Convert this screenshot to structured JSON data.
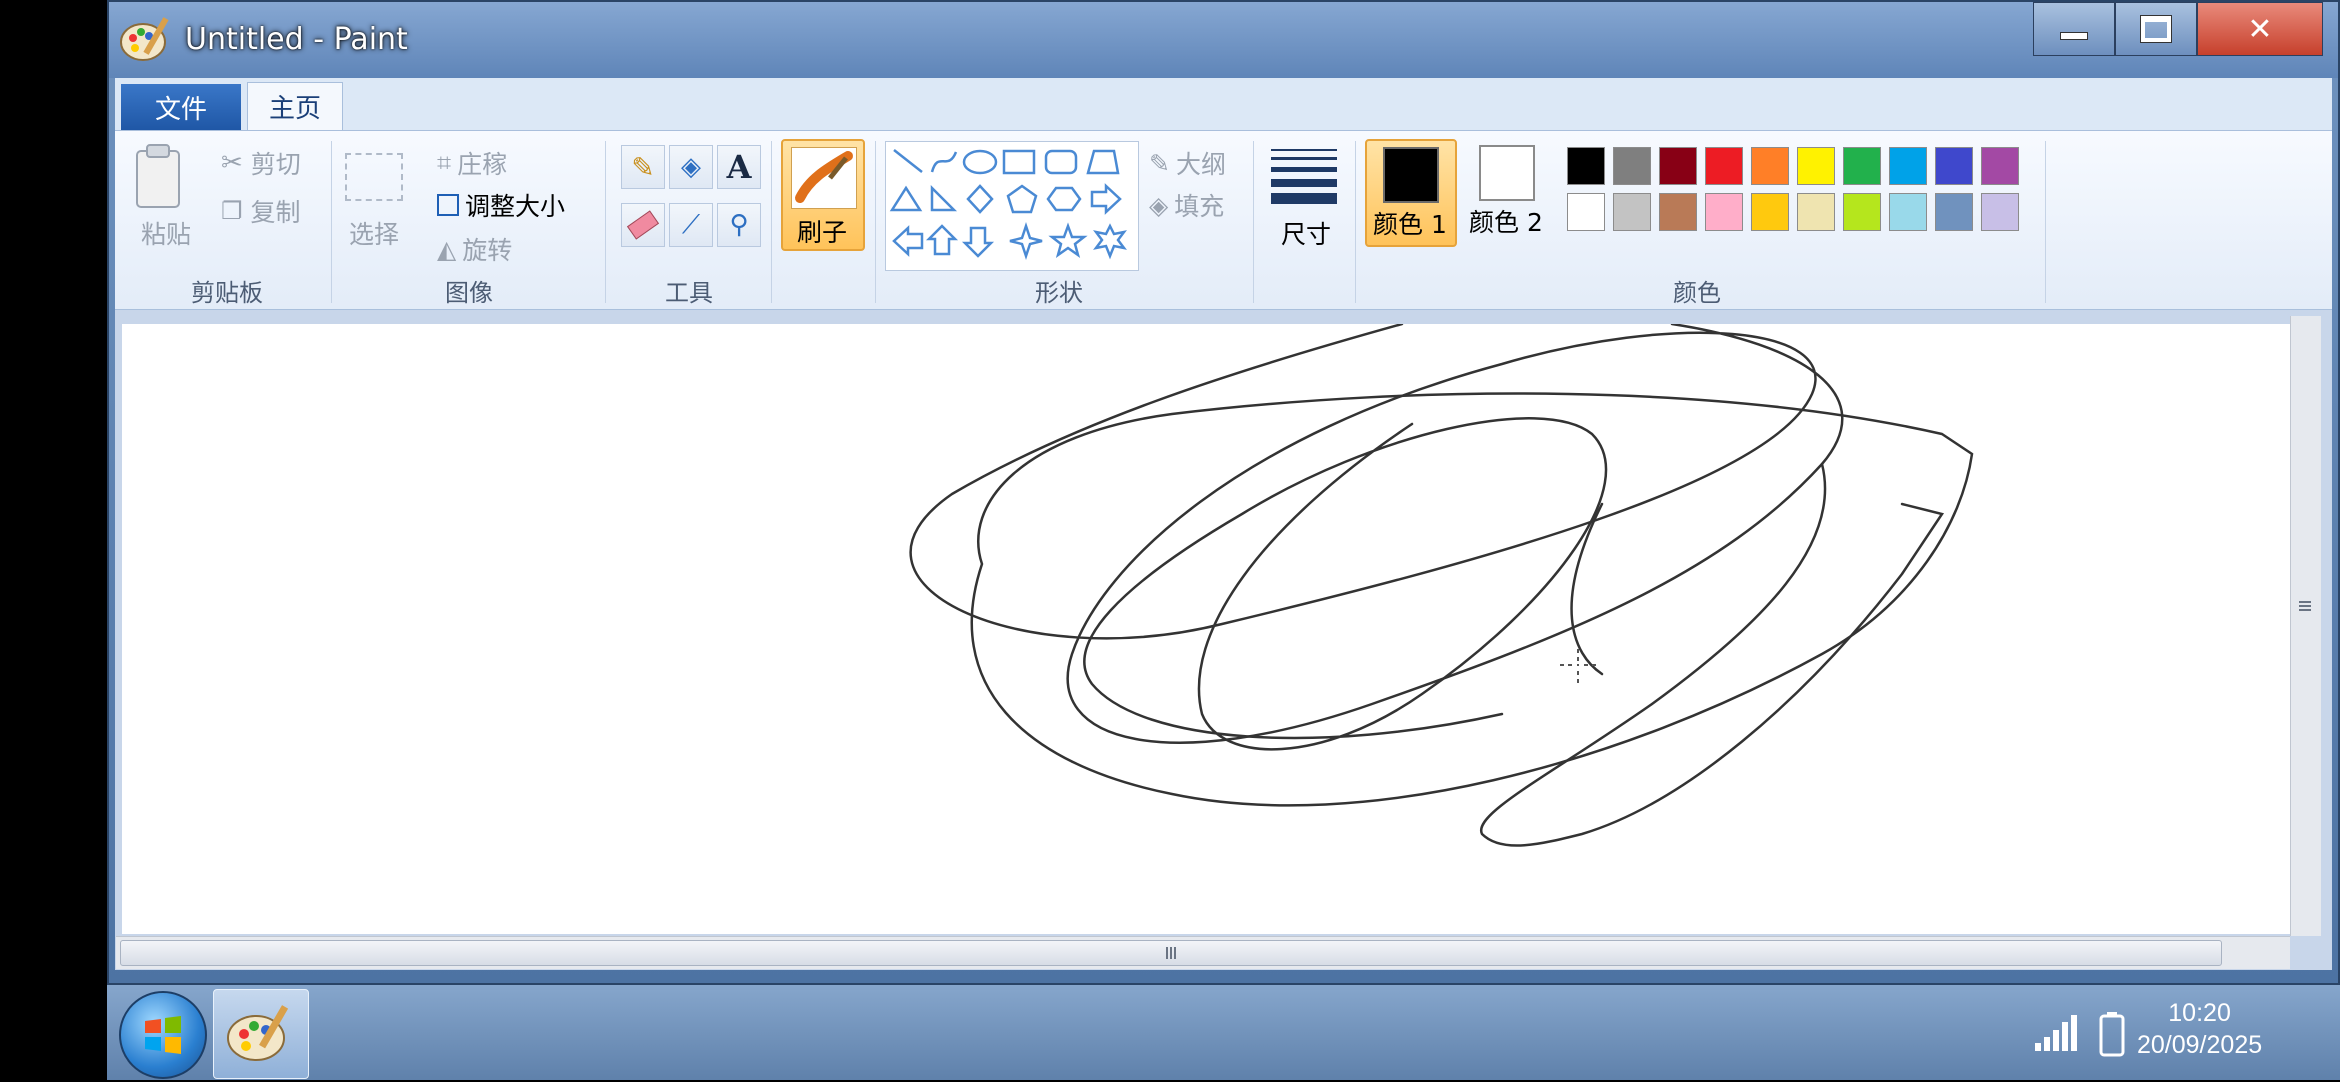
{
  "window": {
    "title": "Untitled - Paint",
    "controls": {
      "minimize": "minimize-icon",
      "maximize": "maximize-icon",
      "close": "close-icon"
    }
  },
  "tabs": {
    "file": "文件",
    "home": "主页"
  },
  "ribbon": {
    "clipboard": {
      "group": "剪贴板",
      "paste": "粘贴",
      "cut": "剪切",
      "copy": "复制"
    },
    "image": {
      "group": "图像",
      "select": "选择",
      "crop": "庄稼",
      "resize": "调整大小",
      "rotate": "旋转"
    },
    "tools": {
      "group": "工具"
    },
    "brushes": {
      "label": "刷子"
    },
    "shapes": {
      "group": "形状",
      "outline": "大纲",
      "fill": "填充"
    },
    "size": {
      "label": "尺寸"
    },
    "colors": {
      "group": "颜色",
      "color1": "颜色 1",
      "color2": "颜色 2",
      "color1_value": "#000000",
      "color2_value": "#ffffff",
      "palette_row1": [
        "#000000",
        "#7f7f7f",
        "#880015",
        "#ed1c24",
        "#ff7f27",
        "#fff200",
        "#22b14c",
        "#00a2e8",
        "#3f48cc",
        "#a349a4"
      ],
      "palette_row2": [
        "#ffffff",
        "#c3c3c3",
        "#b97a57",
        "#ffaec9",
        "#ffc90e",
        "#efe4b0",
        "#b5e61d",
        "#99d9ea",
        "#7092be",
        "#c8bfe7"
      ]
    }
  },
  "taskbar": {
    "time": "10:20",
    "date": "20/09/2025"
  }
}
